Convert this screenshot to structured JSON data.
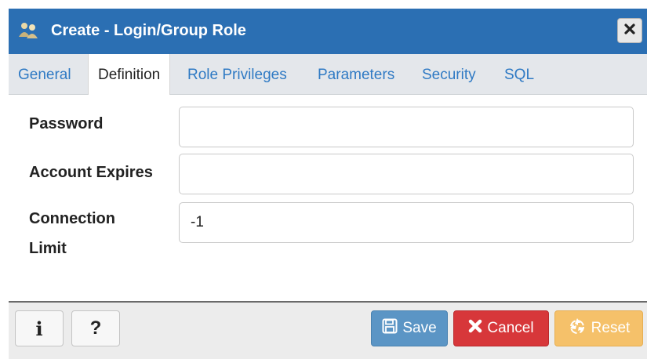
{
  "dialog": {
    "title": "Create - Login/Group Role",
    "title_icon": "role-icon",
    "close_icon": "close-icon",
    "colors": {
      "titlebar": "#2b6fb3",
      "tab_link": "#2f7ac4",
      "save": "#5b95c5",
      "cancel": "#d7373a",
      "reset": "#f5c16a"
    }
  },
  "tabs": [
    {
      "label": "General",
      "active": false
    },
    {
      "label": "Definition",
      "active": true
    },
    {
      "label": "Role Privileges",
      "active": false
    },
    {
      "label": "Parameters",
      "active": false
    },
    {
      "label": "Security",
      "active": false
    },
    {
      "label": "SQL",
      "active": false
    }
  ],
  "form": {
    "password": {
      "label": "Password",
      "value": ""
    },
    "account_expires": {
      "label": "Account Expires",
      "value": ""
    },
    "connection_limit": {
      "label_line1": "Connection",
      "label_line2": "Limit",
      "value": "-1"
    }
  },
  "footer": {
    "info_label": "i",
    "help_label": "?",
    "save_label": "Save",
    "cancel_label": "Cancel",
    "reset_label": "Reset",
    "save_icon": "floppy-disk-icon",
    "cancel_icon": "x-icon",
    "reset_icon": "recycle-icon"
  }
}
